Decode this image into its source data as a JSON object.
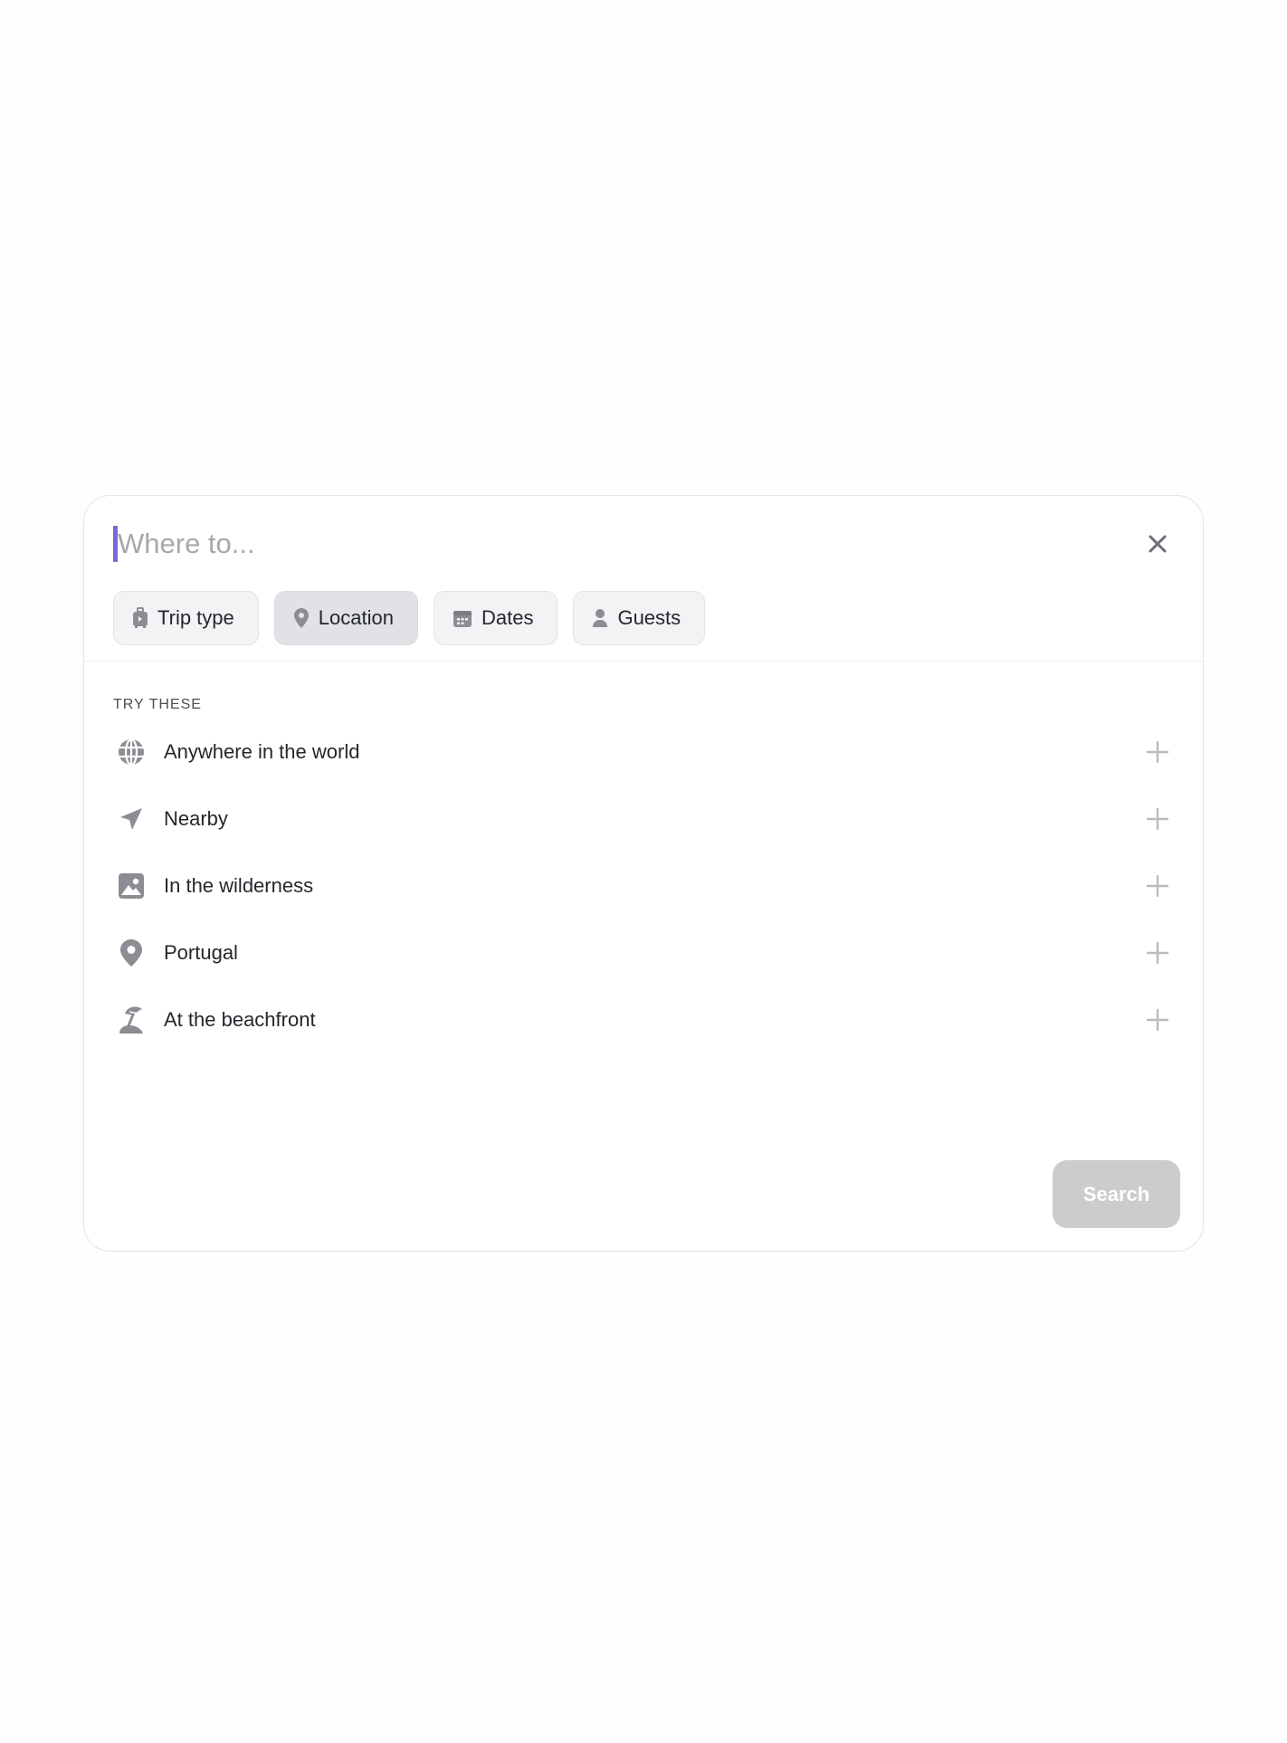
{
  "search": {
    "placeholder": "Where to...",
    "value": ""
  },
  "filters": [
    {
      "label": "Trip type",
      "icon": "suitcase-icon",
      "active": false
    },
    {
      "label": "Location",
      "icon": "map-pin-icon",
      "active": true
    },
    {
      "label": "Dates",
      "icon": "calendar-icon",
      "active": false
    },
    {
      "label": "Guests",
      "icon": "person-icon",
      "active": false
    }
  ],
  "suggestions": {
    "heading": "TRY THESE",
    "items": [
      {
        "label": "Anywhere in the world",
        "icon": "globe-icon"
      },
      {
        "label": "Nearby",
        "icon": "navigation-arrow-icon"
      },
      {
        "label": "In the wilderness",
        "icon": "landscape-image-icon"
      },
      {
        "label": "Portugal",
        "icon": "map-pin-icon"
      },
      {
        "label": "At the beachfront",
        "icon": "beach-umbrella-icon"
      }
    ]
  },
  "actions": {
    "search_label": "Search"
  },
  "colors": {
    "caret": "#7b68d6",
    "icon": "#8b8d93",
    "add_icon": "#b9bbbf",
    "search_button_disabled": "#cbccce"
  }
}
